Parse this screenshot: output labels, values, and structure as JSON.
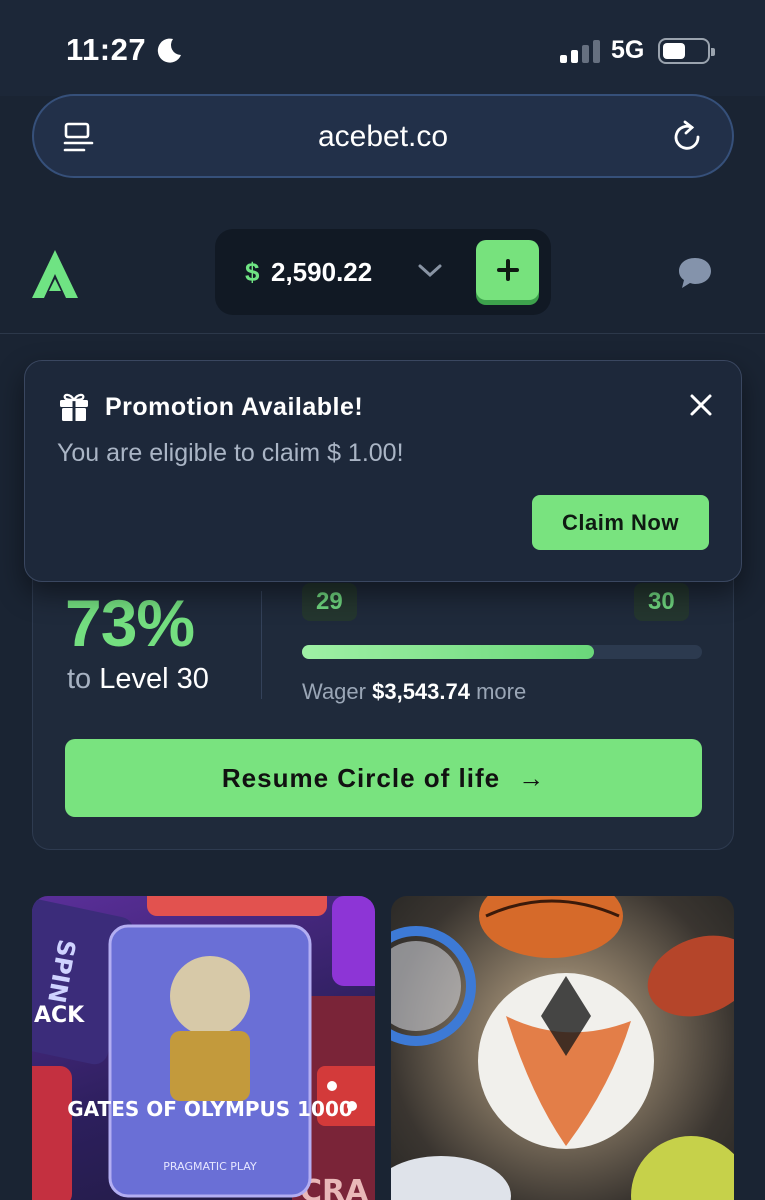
{
  "status": {
    "time": "11:27",
    "network": "5G"
  },
  "browser": {
    "url": "acebet.co"
  },
  "header": {
    "currency_symbol": "$",
    "balance": "2,590.22",
    "deposit_label": "+"
  },
  "promotion": {
    "title": "Promotion Available!",
    "description": "You are eligible to claim $ 1.00!",
    "claim_label": "Claim Now"
  },
  "progress": {
    "percent": "73%",
    "to_text": "to",
    "level_text": "Level 30",
    "current_level": "29",
    "next_level": "30",
    "fill_percent": 73,
    "wager_prefix": "Wager",
    "wager_amount": "$3,543.74",
    "wager_suffix": "more",
    "resume_label": "Resume Circle of life",
    "resume_arrow": "→"
  },
  "tiles": {
    "casino": {
      "spin": "SPIN",
      "jack": "ACK",
      "craps": "CRA",
      "game_title": "GATES OF OLYMPUS 1000",
      "provider": "PRAGMATIC PLAY"
    }
  },
  "colors": {
    "accent": "#79e37f",
    "background": "#1a2433"
  }
}
